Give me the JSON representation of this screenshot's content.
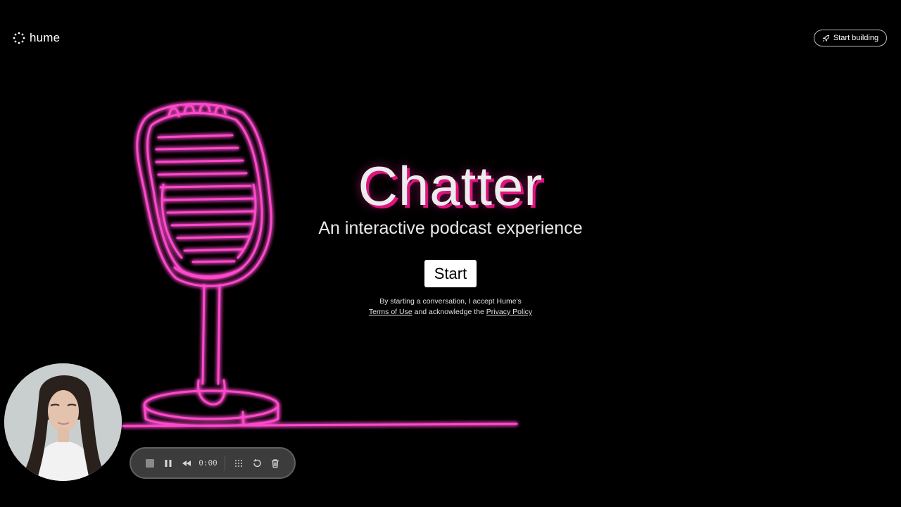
{
  "header": {
    "logo_text": "hume",
    "logo_icon": "dotted-spinner-icon",
    "cta_label": "Start building",
    "cta_icon": "rocket-icon"
  },
  "hero": {
    "title": "Chatter",
    "subtitle": "An interactive podcast experience",
    "start_label": "Start",
    "consent_prefix": "By starting a conversation, I accept Hume's",
    "terms_link": "Terms of Use",
    "consent_middle": "and acknowledge the",
    "privacy_link": "Privacy Policy"
  },
  "recorder": {
    "time": "0:00",
    "buttons": [
      "stop-icon",
      "pause-icon",
      "rewind-icon",
      "grid-icon",
      "restart-icon",
      "trash-icon"
    ]
  },
  "colors": {
    "background": "#000000",
    "neon_pink": "#ff3fc8",
    "title_shadow": "#e0147f"
  }
}
